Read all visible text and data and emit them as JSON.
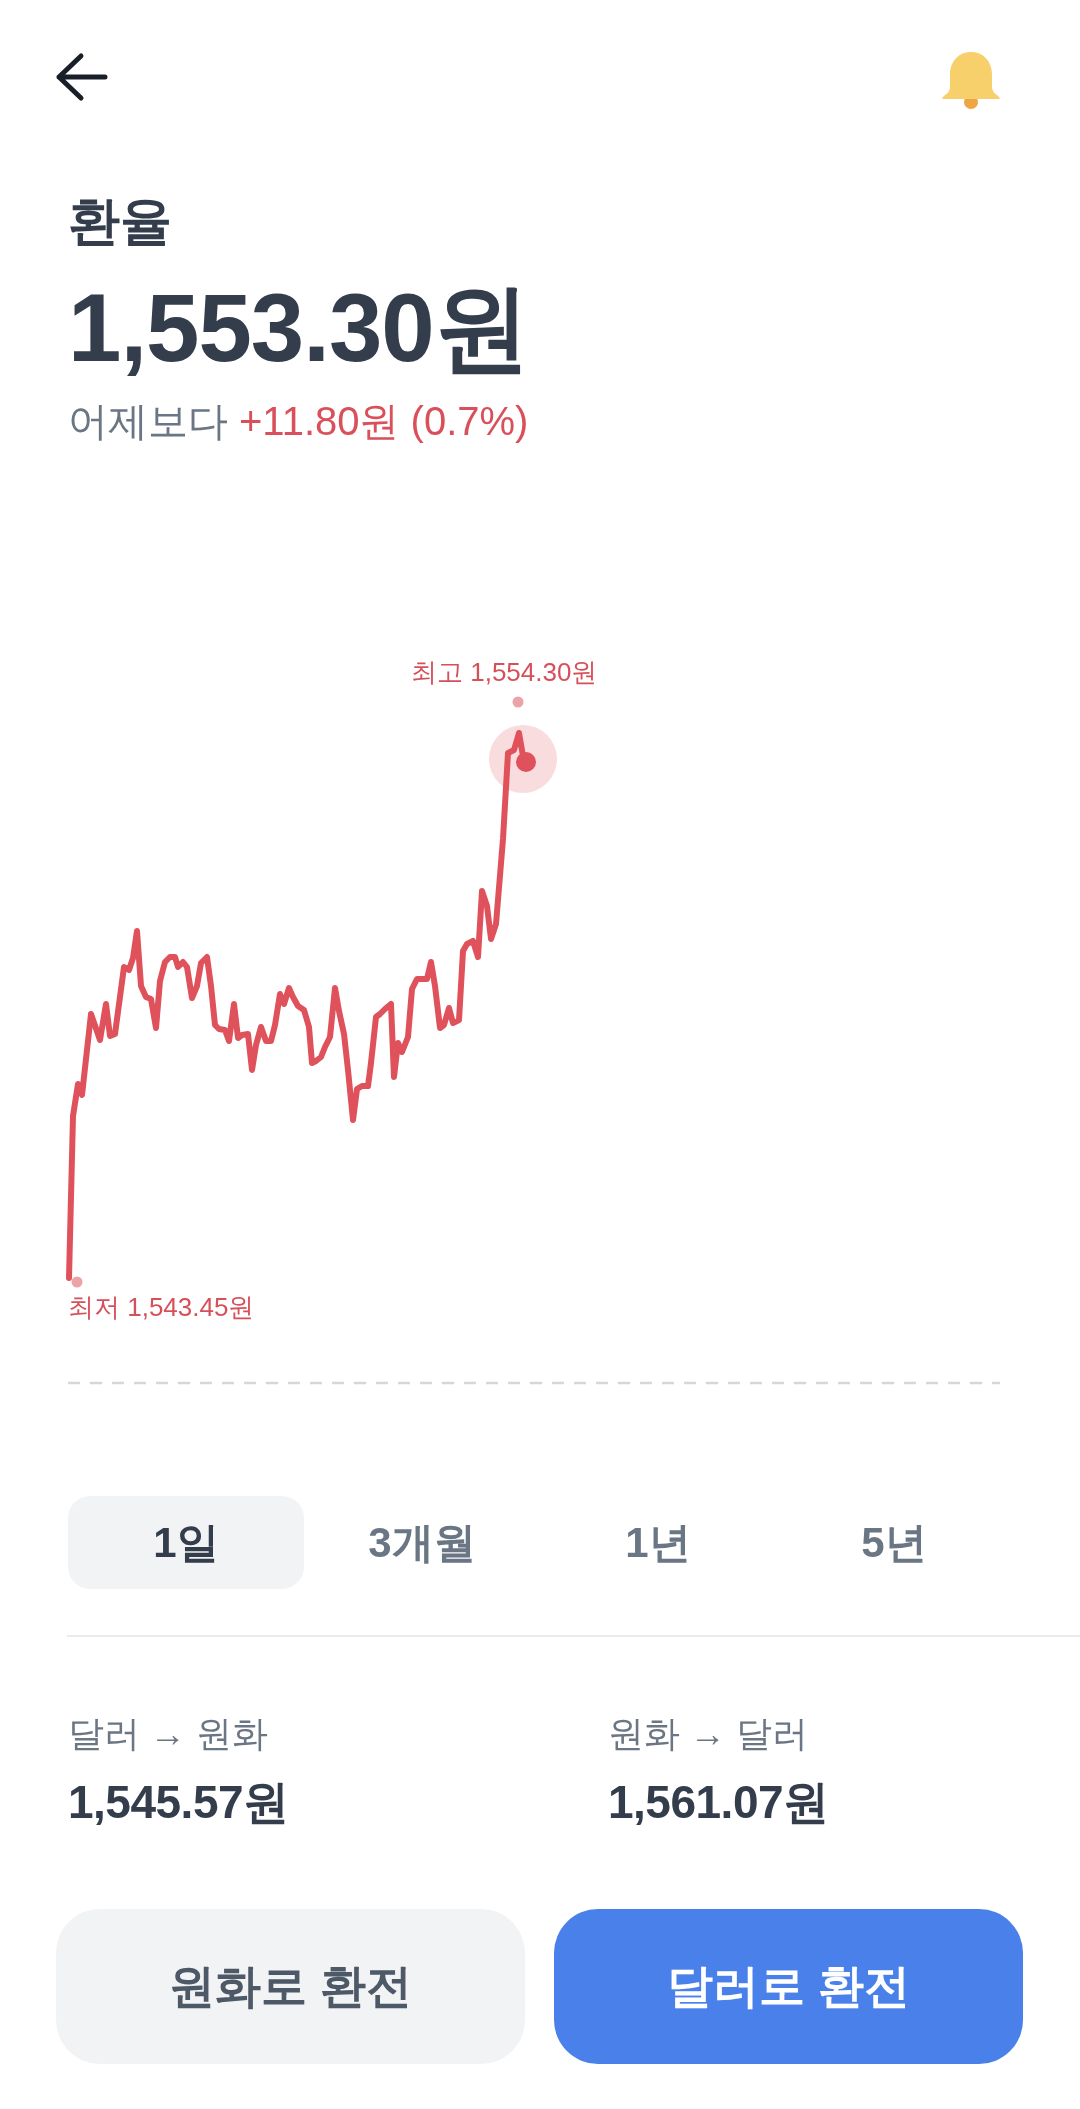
{
  "title": "환율",
  "price": "1,553.30원",
  "change": {
    "label": "어제보다",
    "value": "+11.80원 (0.7%)"
  },
  "chart": {
    "high_label": "최고 1,554.30원",
    "low_label": "최저 1,543.45원"
  },
  "periods": [
    {
      "label": "1일",
      "selected": true
    },
    {
      "label": "3개월",
      "selected": false
    },
    {
      "label": "1년",
      "selected": false
    },
    {
      "label": "5년",
      "selected": false
    }
  ],
  "rates": [
    {
      "label": "달러 → 원화",
      "value": "1,545.57원"
    },
    {
      "label": "원화 → 달러",
      "value": "1,561.07원"
    }
  ],
  "buttons": [
    {
      "label": "원화로 환전",
      "kind": "secondary"
    },
    {
      "label": "달러로 환전",
      "kind": "primary"
    }
  ]
}
